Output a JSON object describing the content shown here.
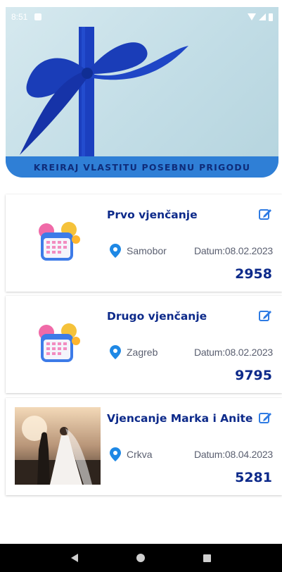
{
  "status_bar": {
    "time": "8:51"
  },
  "banner": {
    "cta_label": "KREIRAJ VLASTITU POSEBNU PRIGODU"
  },
  "events": [
    {
      "title": "Prvo vjenčanje",
      "location": "Samobor",
      "date": "Datum:08.02.2023",
      "number": "2958",
      "thumbnail": "calendar-balloons-icon"
    },
    {
      "title": "Drugo vjenčanje",
      "location": "Zagreb",
      "date": "Datum:08.02.2023",
      "number": "9795",
      "thumbnail": "calendar-balloons-icon"
    },
    {
      "title": "Vjencanje Marka i Anite",
      "location": "Crkva",
      "date": "Datum:08.04.2023",
      "number": "5281",
      "thumbnail": "wedding-photo"
    }
  ],
  "colors": {
    "accent": "#0d2a8a",
    "pin": "#1e88e5",
    "ribbon": "#1b3fbf",
    "banner_strip": "#2f7fd6"
  }
}
